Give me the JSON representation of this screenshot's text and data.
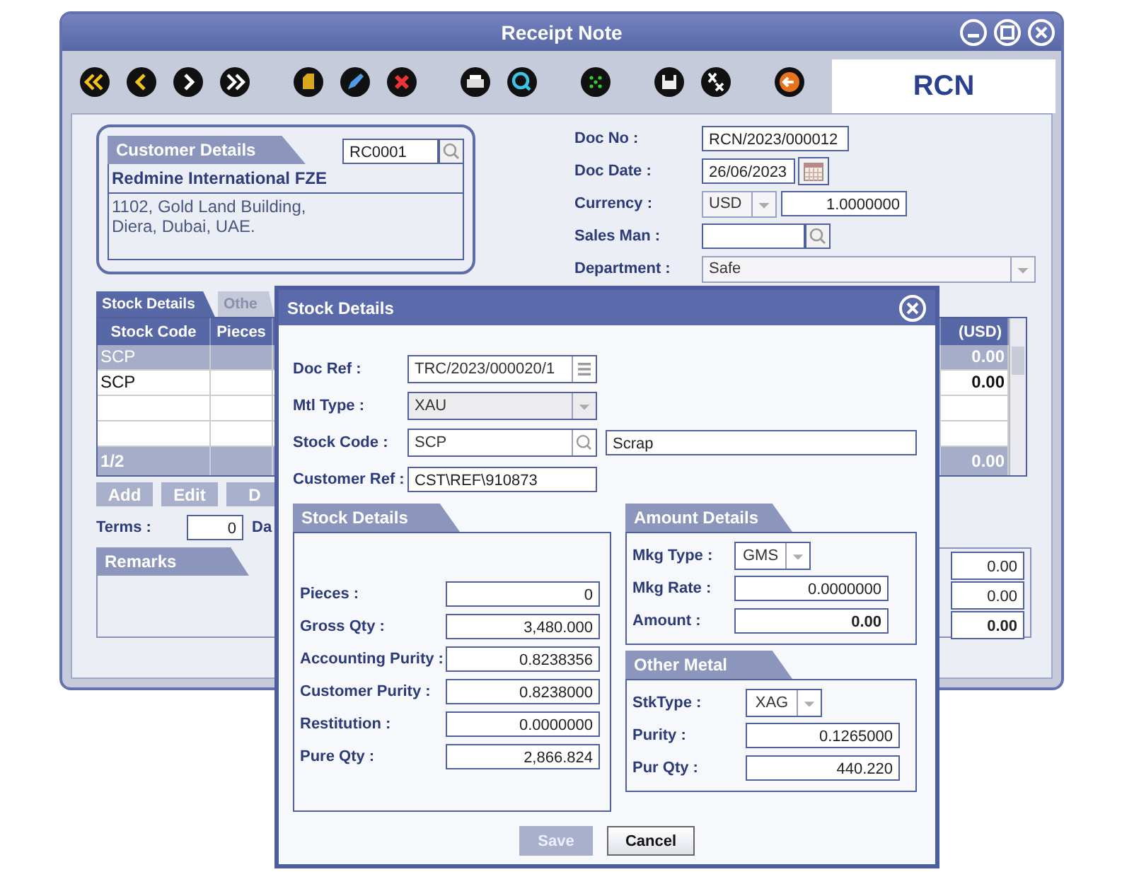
{
  "window": {
    "title": "Receipt Note"
  },
  "badge": "RCN",
  "customer": {
    "tab": "Customer Details",
    "code": "RC0001",
    "name": "Redmine International FZE",
    "address": [
      "1102, Gold Land Building,",
      "Diera, Dubai, UAE."
    ]
  },
  "header_fields": [
    {
      "label": "Doc No :",
      "kind": "text",
      "value": "RCN/2023/000012"
    },
    {
      "label": "Doc Date :",
      "kind": "date",
      "value": "26/06/2023"
    },
    {
      "label": "Currency :",
      "kind": "currency",
      "value": "USD",
      "rate": "1.0000000"
    },
    {
      "label": "Sales Man :",
      "kind": "lookup"
    },
    {
      "label": "Department :",
      "kind": "select",
      "value": "Safe"
    }
  ],
  "tabs": [
    {
      "label": "Stock Details",
      "selected": true
    },
    {
      "label": "Othe",
      "selected": false
    }
  ],
  "grid": {
    "columns": [
      "Stock Code",
      "Pieces",
      "(USD)"
    ],
    "rows": [
      {
        "code": "SCP",
        "amount": "0.00",
        "selected": true
      },
      {
        "code": "SCP",
        "amount": "0.00",
        "selected": false
      }
    ],
    "footer": {
      "count": "1/2",
      "amount": "0.00"
    }
  },
  "grid_buttons": [
    "Add",
    "Edit",
    "D"
  ],
  "terms": {
    "label": "Terms :",
    "value": "0",
    "next_label": "Da"
  },
  "remarks": {
    "tab": "Remarks"
  },
  "totals": [
    {
      "value": "0.00",
      "bold": false
    },
    {
      "value": "0.00",
      "bold": false
    },
    {
      "value": "0.00",
      "bold": true
    }
  ],
  "dialog": {
    "title": "Stock Details",
    "fields": [
      {
        "label": "Doc Ref :",
        "kind": "list",
        "value": "TRC/2023/000020/1"
      },
      {
        "label": "Mtl Type :",
        "kind": "select",
        "value": "XAU",
        "disabled": true
      },
      {
        "label": "Stock Code :",
        "kind": "lookup",
        "value": "SCP",
        "description": "Scrap"
      },
      {
        "label": "Customer Ref :",
        "kind": "text",
        "value": "CST\\REF\\910873"
      }
    ],
    "stock_details": {
      "title": "Stock Details",
      "fields": [
        {
          "label": "Pieces :",
          "kind": "number",
          "value": "0"
        },
        {
          "label": "Gross Qty :",
          "kind": "number",
          "value": "3,480.000"
        },
        {
          "label": "Accounting Purity :",
          "kind": "number",
          "value": "0.8238356"
        },
        {
          "label": "Customer Purity :",
          "kind": "number",
          "value": "0.8238000"
        },
        {
          "label": "Restitution :",
          "kind": "number",
          "value": "0.0000000"
        },
        {
          "label": "Pure Qty :",
          "kind": "number",
          "value": "2,866.824"
        }
      ]
    },
    "amount_details": {
      "title": "Amount Details",
      "fields": [
        {
          "label": "Mkg Type :",
          "kind": "select",
          "value": "GMS"
        },
        {
          "label": "Mkg Rate :",
          "kind": "number",
          "value": "0.0000000"
        },
        {
          "label": "Amount :",
          "kind": "number",
          "value": "0.00",
          "bold": true
        }
      ]
    },
    "other_metal": {
      "title": "Other Metal",
      "fields": [
        {
          "label": "StkType :",
          "kind": "select",
          "value": "XAG"
        },
        {
          "label": "Purity :",
          "kind": "number",
          "value": "0.1265000"
        },
        {
          "label": "Pur Qty :",
          "kind": "number",
          "value": "440.220"
        }
      ]
    },
    "buttons": [
      {
        "label": "Save",
        "disabled": true
      },
      {
        "label": "Cancel",
        "disabled": false
      }
    ]
  }
}
